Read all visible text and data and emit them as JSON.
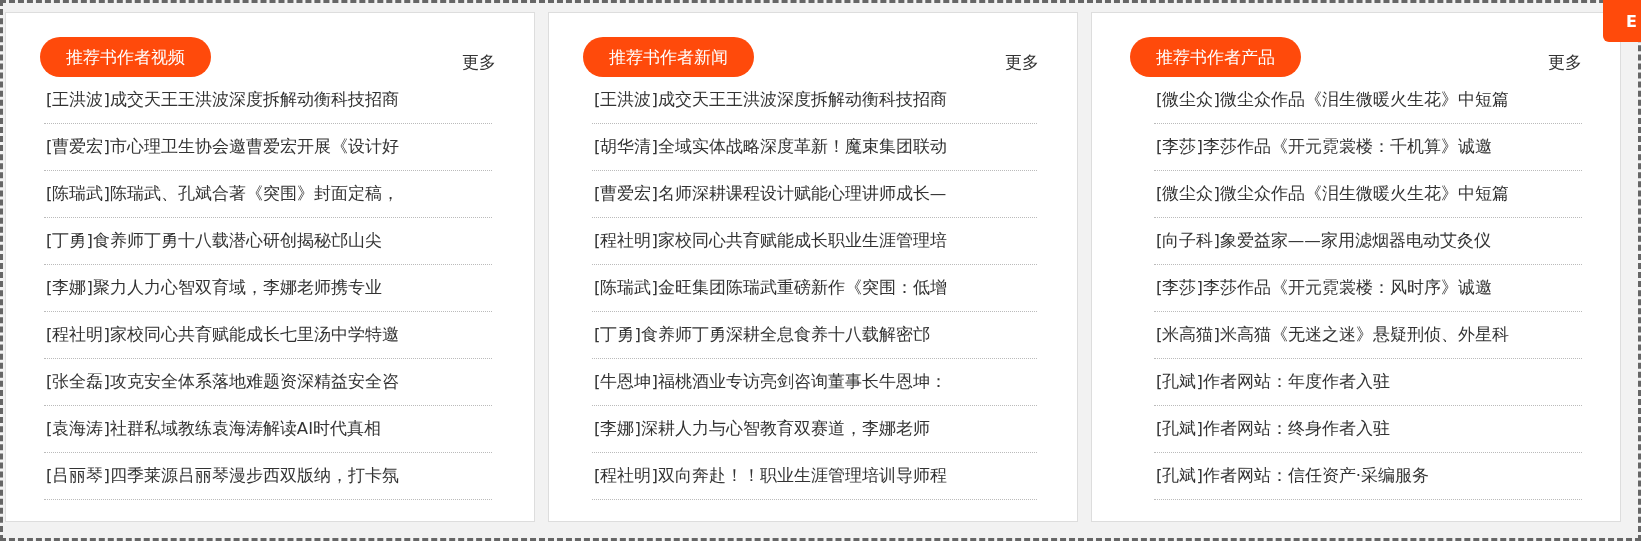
{
  "panels": [
    {
      "title": "推荐书作者视频",
      "more": "更多",
      "items": [
        "[王洪波]成交天王王洪波深度拆解动衡科技招商",
        "[曹爱宏]市心理卫生协会邀曹爱宏开展《设计好",
        "[陈瑞武]陈瑞武、孔斌合著《突围》封面定稿，",
        "[丁勇]食养师丁勇十八载潜心研创揭秘邙山尖",
        "[李娜]聚力人力心智双育域，李娜老师携专业",
        "[程社明]家校同心共育赋能成长七里汤中学特邀",
        "[张全磊]攻克安全体系落地难题资深精益安全咨",
        "[袁海涛]社群私域教练袁海涛解读AI时代真相",
        "[吕丽琴]四季莱源吕丽琴漫步西双版纳，打卡氛"
      ]
    },
    {
      "title": "推荐书作者新闻",
      "more": "更多",
      "items": [
        "[王洪波]成交天王王洪波深度拆解动衡科技招商",
        "[胡华清]全域实体战略深度革新！魔束集团联动",
        "[曹爱宏]名师深耕课程设计赋能心理讲师成长—",
        "[程社明]家校同心共育赋能成长职业生涯管理培",
        "[陈瑞武]金旺集团陈瑞武重磅新作《突围：低增",
        "[丁勇]食养师丁勇深耕全息食养十八载解密邙",
        "[牛恩坤]福桃酒业专访亮剑咨询董事长牛恩坤：",
        "[李娜]深耕人力与心智教育双赛道，李娜老师",
        "[程社明]双向奔赴！！职业生涯管理培训导师程"
      ]
    },
    {
      "title": "推荐书作者产品",
      "more": "更多",
      "items": [
        "[微尘众]微尘众作品《泪生微暖火生花》中短篇",
        "[李莎]李莎作品《开元霓裳楼：千机算》诚邀",
        "[微尘众]微尘众作品《泪生微暖火生花》中短篇",
        "[向子科]象爱益家——家用滤烟器电动艾灸仪",
        "[李莎]李莎作品《开元霓裳楼：风时序》诚邀",
        "[米高猫]米高猫《无迷之迷》悬疑刑侦、外星科",
        "[孔斌]作者网站：年度作者入驻",
        "[孔斌]作者网站：终身作者入驻",
        "[孔斌]作者网站：信任资产·采编服务"
      ]
    }
  ],
  "side_tab": {
    "label": "E"
  }
}
